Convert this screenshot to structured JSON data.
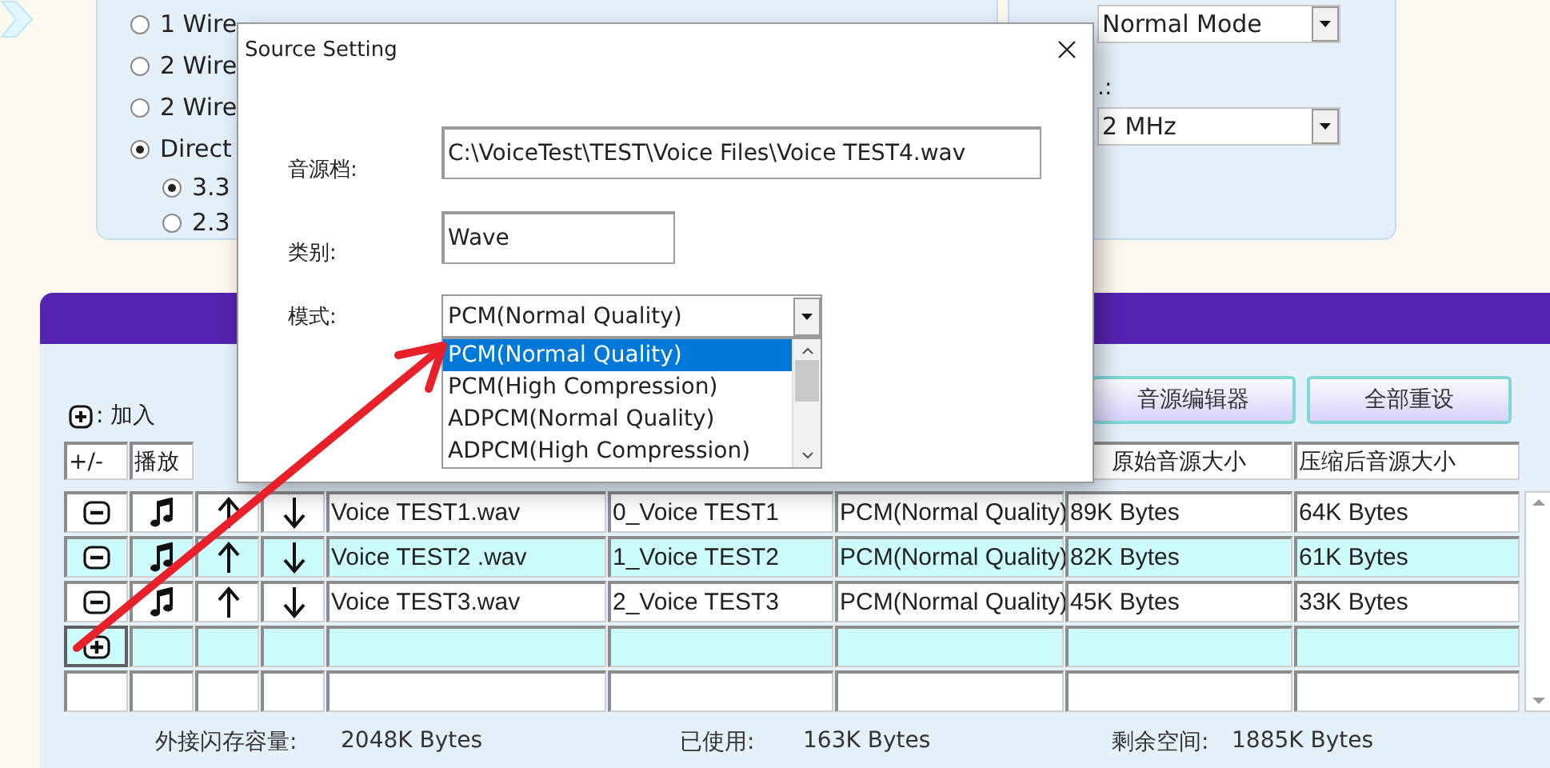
{
  "config_panel": {
    "radios": [
      {
        "label": "1 Wire",
        "selected": false
      },
      {
        "label": "2 Wire",
        "selected": false
      },
      {
        "label": "2 Wire",
        "selected": false
      },
      {
        "label": "Direct",
        "selected": true,
        "children": [
          {
            "label": "3.3",
            "selected": true
          },
          {
            "label": "2.3",
            "selected": false
          }
        ]
      }
    ]
  },
  "mode_panel": {
    "mode_select": {
      "value": "Normal Mode"
    },
    "clock_label": ".:",
    "clock_select": {
      "value": "2 MHz"
    }
  },
  "voice_panel": {
    "legend": ": 加入",
    "buttons": [
      "音源编辑器",
      "全部重设"
    ],
    "headers_left": [
      "+/-",
      "播放"
    ],
    "headers_right": [
      "原始音源大小",
      "压缩后音源大小"
    ],
    "rows": [
      {
        "kind": "voice",
        "file": "Voice TEST1.wav",
        "name": "0_Voice TEST1",
        "mode": "PCM(Normal Quality)",
        "original_size": "89K Bytes",
        "compressed_size": "64K Bytes"
      },
      {
        "kind": "voice",
        "file": "Voice TEST2 .wav",
        "name": "1_Voice TEST2",
        "mode": "PCM(Normal Quality)",
        "original_size": "82K Bytes",
        "compressed_size": "61K Bytes"
      },
      {
        "kind": "voice",
        "file": "Voice TEST3.wav",
        "name": "2_Voice TEST3",
        "mode": "PCM(Normal Quality)",
        "original_size": "45K Bytes",
        "compressed_size": "33K Bytes"
      },
      {
        "kind": "add"
      },
      {
        "kind": "empty"
      }
    ],
    "footer": [
      {
        "label": "外接闪存容量:",
        "value": "2048K Bytes"
      },
      {
        "label": "已使用:",
        "value": "163K Bytes"
      },
      {
        "label": "剩余空间:",
        "value": "1885K Bytes"
      }
    ]
  },
  "dialog": {
    "title": "Source Setting",
    "fields": [
      {
        "kind": "text",
        "label": "音源档:",
        "value": "C:\\VoiceTest\\TEST\\Voice Files\\Voice TEST4.wav"
      },
      {
        "kind": "text",
        "label": "类别:",
        "value": "Wave"
      },
      {
        "kind": "select",
        "label": "模式:",
        "value": "PCM(Normal Quality)",
        "expanded": true,
        "options": [
          {
            "label": "PCM(Normal Quality)",
            "selected": true
          },
          {
            "label": "PCM(High Compression)",
            "selected": false
          },
          {
            "label": "ADPCM(Normal Quality)",
            "selected": false
          },
          {
            "label": "ADPCM(High Compression)",
            "selected": false
          }
        ]
      }
    ]
  }
}
